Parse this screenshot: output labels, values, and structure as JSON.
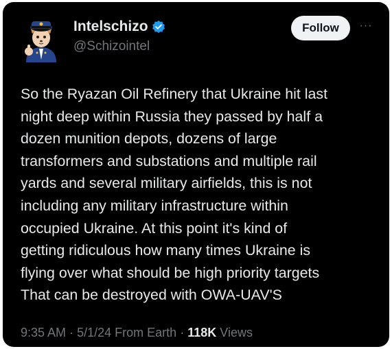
{
  "author": {
    "display_name": "Intelschizo",
    "handle": "@Schizointel",
    "avatar_icon": "officer-cartoon-avatar",
    "verified_icon": "verified-badge-icon",
    "verified_color": "#1d9bf0"
  },
  "actions": {
    "follow_label": "Follow",
    "more_label": "···"
  },
  "tweet": {
    "lines": [
      "So the Ryazan Oil Refinery that Ukraine hit last",
      "night deep within Russia they passed by half a",
      "dozen munition depots, dozens of large",
      "transformers and substations and multiple rail",
      "yards and several military airfields, this is not",
      "including any military infrastructure within",
      "occupied Ukraine. At this point it's kind of",
      "getting ridiculous how many times Ukraine is",
      "flying over what should be high priority targets",
      "That can be destroyed with OWA-UAV'S"
    ]
  },
  "meta": {
    "time": "9:35 AM",
    "date": "5/1/24",
    "source": "From Earth",
    "separator": "·",
    "views_count": "118K",
    "views_label": "Views"
  },
  "colors": {
    "background": "#000000",
    "text_primary": "#e7e9ea",
    "text_secondary": "#71767b",
    "follow_button_bg": "#eff3f4"
  }
}
